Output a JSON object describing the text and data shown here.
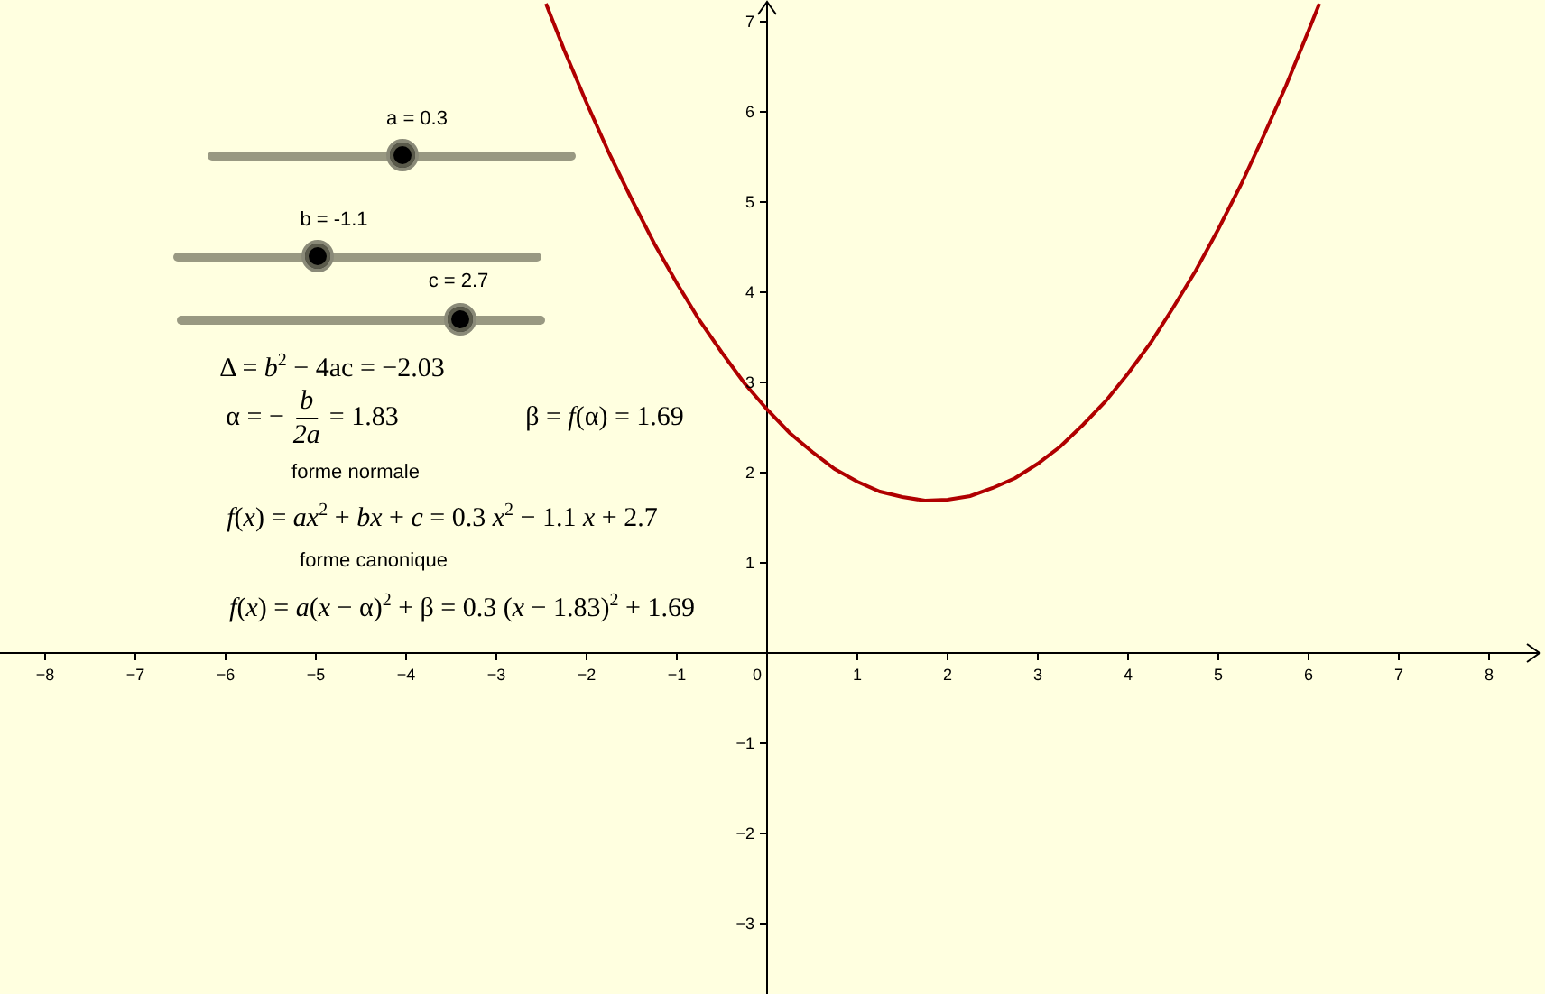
{
  "sliders": [
    {
      "label": "a = 0.3",
      "level": 0.53
    },
    {
      "label": "b = -1.1",
      "level": 0.39
    },
    {
      "label": "c = 2.7",
      "level": 0.77
    }
  ],
  "formulas": {
    "delta": "Δ = *b*$^{2}$ − 4ac = −2.03",
    "alpha": {
      "prefix": "α = −",
      "numerator": "b",
      "denominator": "2a",
      "suffix": "= 1.83"
    },
    "beta": "β = *f*(α) = 1.69",
    "normal_label": "forme normale",
    "normal": "*f*(*x*) = *ax*$^{2}$ + *bx* + *c* = 0.3 *x*$^{2}$ − 1.1 *x* + 2.7",
    "canonical_label": "forme canonique",
    "canonical": "*f*(*x*) = *a*(*x* − α)$^{2}$ + β = 0.3 (*x* − 1.83)$^{2}$ + 1.69"
  },
  "graph": {
    "chart_data": {
      "type": "line",
      "xlim": [
        -8.5,
        8.62
      ],
      "ylim": [
        -3.78,
        7.24
      ],
      "xticks": [
        -8,
        -7,
        -6,
        -5,
        -4,
        -3,
        -2,
        -1,
        0,
        1,
        2,
        3,
        4,
        5,
        6,
        7,
        8
      ],
      "yticks": [
        -3,
        -2,
        -1,
        1,
        2,
        3,
        4,
        5,
        6,
        7
      ],
      "x": [
        -2.45,
        -2.25,
        -2,
        -1.75,
        -1.5,
        -1.25,
        -1,
        -0.75,
        -0.5,
        -0.25,
        0,
        0.25,
        0.5,
        0.75,
        1,
        1.25,
        1.5,
        1.75,
        2,
        2.25,
        2.5,
        2.75,
        3,
        3.25,
        3.5,
        3.75,
        4,
        4.25,
        4.5,
        4.75,
        5,
        5.25,
        5.5,
        5.75,
        6,
        6.12
      ],
      "series": [
        {
          "color": "#b00000",
          "values": [
            7.2,
            6.69,
            6.1,
            5.54,
            5.03,
            4.54,
            4.1,
            3.69,
            3.33,
            2.99,
            2.7,
            2.44,
            2.23,
            2.04,
            1.9,
            1.79,
            1.73,
            1.69,
            1.7,
            1.74,
            1.83,
            1.94,
            2.1,
            2.29,
            2.53,
            2.79,
            3.1,
            3.44,
            3.83,
            4.24,
            4.7,
            5.19,
            5.73,
            6.29,
            6.9,
            7.2
          ]
        }
      ]
    }
  }
}
